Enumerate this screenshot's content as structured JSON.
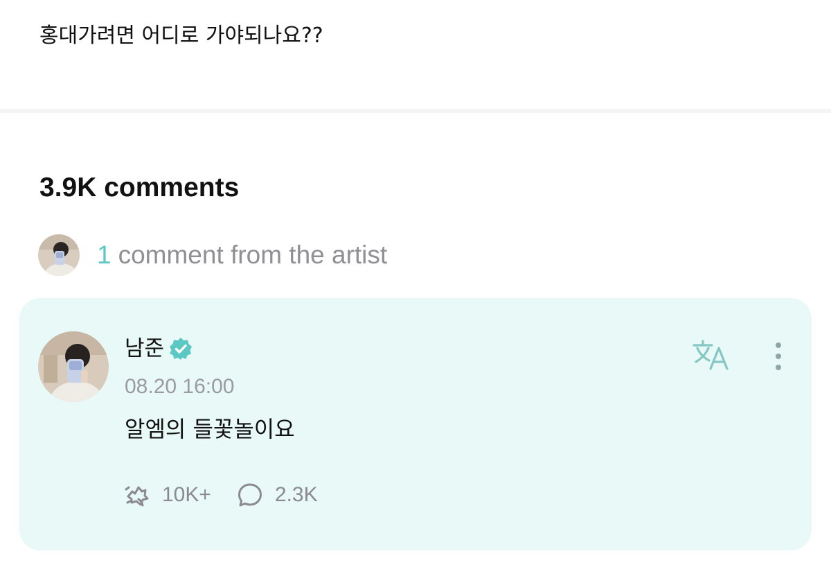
{
  "post": {
    "text": "홍대가려면 어디로 가야되나요??"
  },
  "comments": {
    "heading": "3.9K comments",
    "artist_summary": {
      "count": "1",
      "label": "comment from the artist"
    }
  },
  "artist_comment": {
    "author": "남준",
    "verified_icon": "verified-badge-icon",
    "timestamp": "08.20 16:00",
    "body": "알엠의 들꽃놀이요",
    "likes": "10K+",
    "replies": "2.3K",
    "icons": {
      "translate": "translate-icon",
      "more": "more-vertical-icon",
      "like": "cheer-icon",
      "reply": "speech-bubble-icon"
    }
  },
  "colors": {
    "accent": "#5cc8c4",
    "card_background": "#e8f9f7",
    "muted_text": "#8f8f95",
    "icon_grey": "#8a8a90"
  }
}
